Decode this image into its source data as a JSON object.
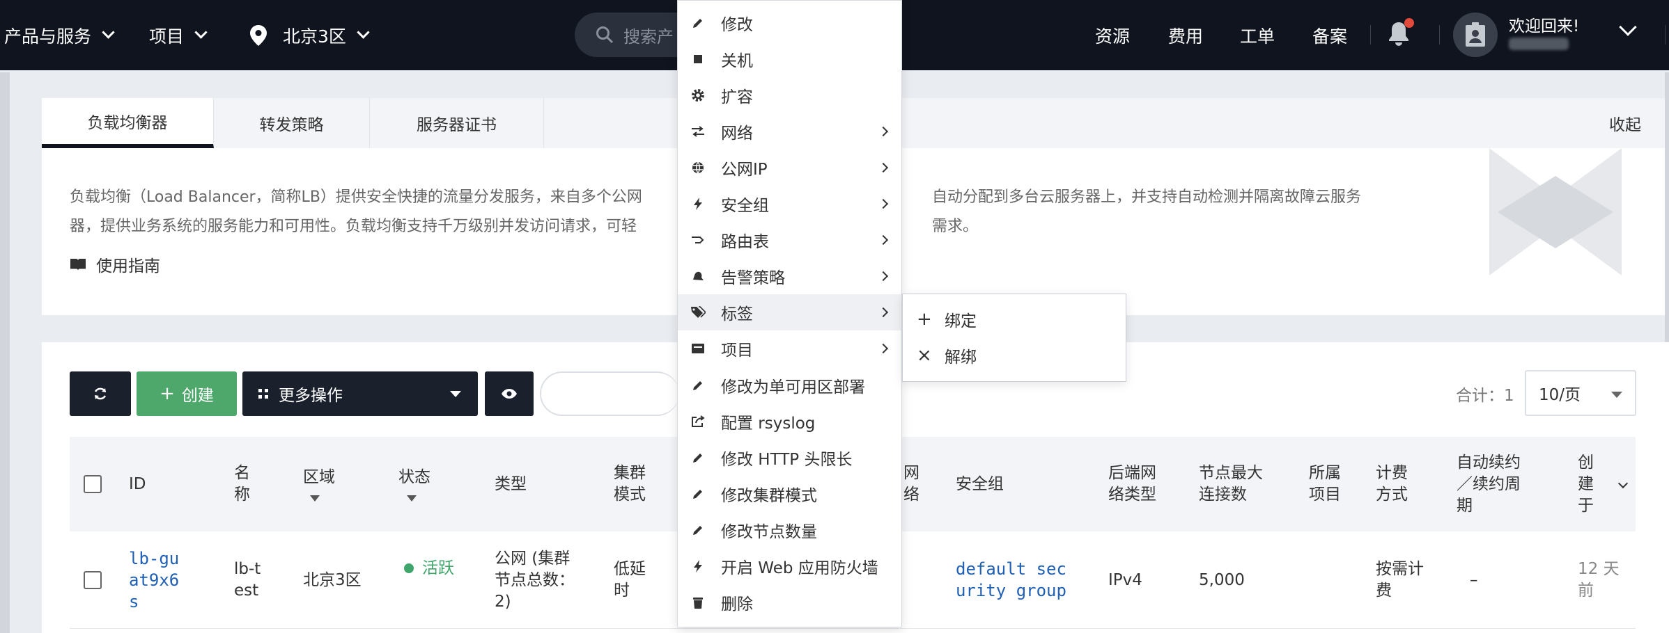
{
  "topnav": {
    "products_label": "产品与服务",
    "project_label": "项目",
    "region_label": "北京3区",
    "search_placeholder": "搜索产",
    "links": [
      "资源",
      "费用",
      "工单",
      "备案"
    ],
    "welcome": "欢迎回来!",
    "notification_color": "#e24b3b",
    "icons": [
      "chevron-down-icon",
      "location-pin-icon",
      "search-icon",
      "bell-icon",
      "user-badge-icon"
    ]
  },
  "info": {
    "tabs": [
      "负载均衡器",
      "转发策略",
      "服务器证书"
    ],
    "collapse_label": "收起",
    "description": "负载均衡（Load Balancer，简称LB）提供安全快捷的流量分发服务，来自多个公网地址的访问流量经过负载均衡器，可根据预先配置的转发策略，自动分配到多台云服务器上，并支持自动检测并隔离故障云服务器，提供业务系统的服务能力和可用性。负载均衡支持千万级别并发访问请求，可轻松应对大流量访问，满足业务需求。",
    "desc_line1": "负载均衡（Load Balancer，简称LB）提供安全快捷的流量分发服务，来自多个公网",
    "desc_line1_right": "自动分配到多台云服务器上，并支持自动检测并隔离故障云服务",
    "desc_line2": "器，提供业务系统的服务能力和可用性。负载均衡支持千万级别并发访问请求，可轻",
    "desc_line2_right": "需求。",
    "guide_label": "使用指南"
  },
  "toolbar": {
    "create_label": "创建",
    "more_label": "更多操作",
    "total_label": "合计：1",
    "page_size": "10/页",
    "create_color": "#4ea86b",
    "dark_color": "#1a212c"
  },
  "table": {
    "headers": {
      "id": "ID",
      "name": "名称",
      "region": "区域",
      "status": "状态",
      "type": "类型",
      "cluster_mode": "集群模式",
      "network": "网络",
      "security_group": "安全组",
      "backend_net_type": "后端网络类型",
      "max_conn": "节点最大连接数",
      "project": "所属项目",
      "billing": "计费方式",
      "renew": "自动续约／续约周期",
      "created": "创建于"
    },
    "row": {
      "id": "lb-guat9x6s",
      "name": "lb-test",
      "region": "北京3区",
      "status": "活跃",
      "status_color": "#3ea66a",
      "type": "公网 (集群节点总数：2)",
      "cluster_mode": "低延时",
      "security_group": "default security group",
      "backend_net_type": "IPv4",
      "max_conn": "5,000",
      "project": "",
      "billing": "按需计费",
      "renew": "–",
      "created": "12 天前"
    }
  },
  "menu": {
    "items": [
      {
        "label": "修改",
        "icon": "pencil-icon",
        "submenu": false
      },
      {
        "label": "关机",
        "icon": "stop-icon",
        "submenu": false
      },
      {
        "label": "扩容",
        "icon": "gear-icon",
        "submenu": false
      },
      {
        "label": "网络",
        "icon": "network-icon",
        "submenu": true
      },
      {
        "label": "公网IP",
        "icon": "globe-icon",
        "submenu": true
      },
      {
        "label": "安全组",
        "icon": "bolt-icon",
        "submenu": true
      },
      {
        "label": "路由表",
        "icon": "route-icon",
        "submenu": true
      },
      {
        "label": "告警策略",
        "icon": "bell-icon",
        "submenu": true
      },
      {
        "label": "标签",
        "icon": "tag-icon",
        "submenu": true
      },
      {
        "label": "项目",
        "icon": "folder-icon",
        "submenu": true
      },
      {
        "label": "修改为单可用区部署",
        "icon": "pencil-icon",
        "submenu": false
      },
      {
        "label": "配置 rsyslog",
        "icon": "export-icon",
        "submenu": false
      },
      {
        "label": "修改 HTTP 头限长",
        "icon": "pencil-icon",
        "submenu": false
      },
      {
        "label": "修改集群模式",
        "icon": "pencil-icon",
        "submenu": false
      },
      {
        "label": "修改节点数量",
        "icon": "pencil-icon",
        "submenu": false
      },
      {
        "label": "开启 Web 应用防火墙",
        "icon": "bolt-icon",
        "submenu": false
      },
      {
        "label": "删除",
        "icon": "trash-icon",
        "submenu": false
      }
    ],
    "highlighted_index": 8,
    "submenu_items": [
      {
        "label": "绑定",
        "icon": "plus-icon"
      },
      {
        "label": "解绑",
        "icon": "close-icon"
      }
    ]
  }
}
